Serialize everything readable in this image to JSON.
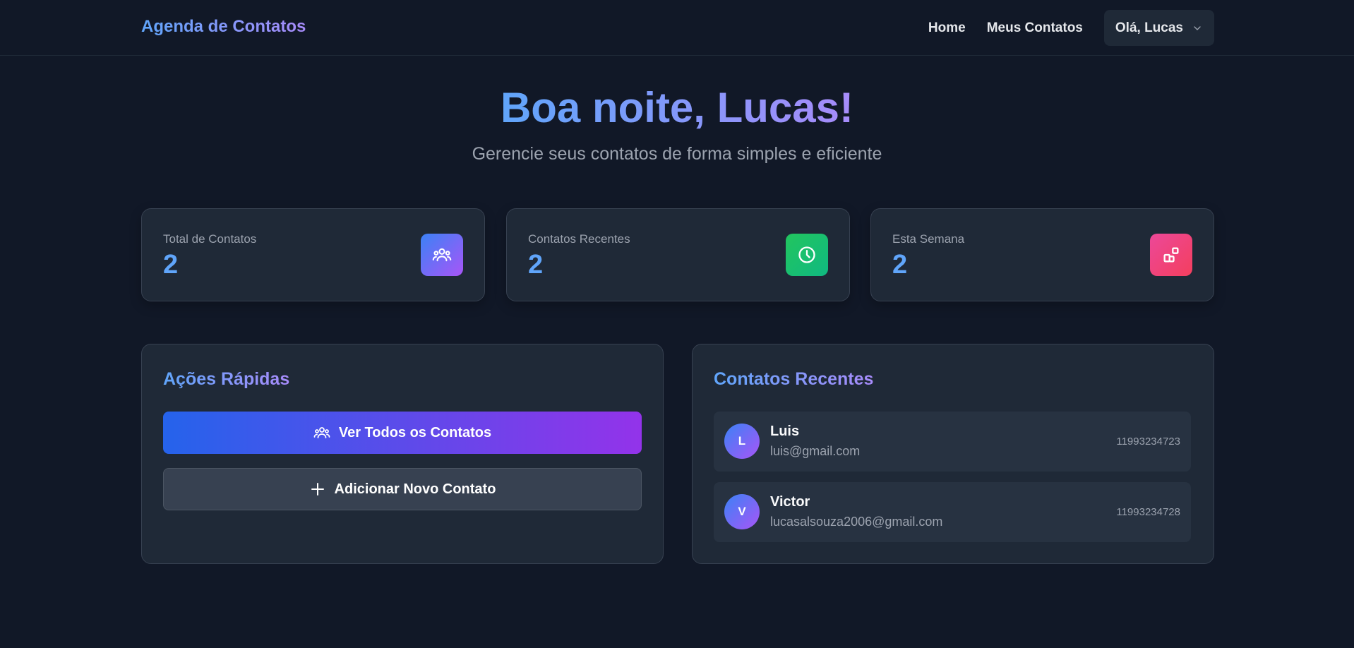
{
  "navbar": {
    "brand": "Agenda de Contatos",
    "links": [
      "Home",
      "Meus Contatos"
    ],
    "user_menu_label": "Olá, Lucas"
  },
  "hero": {
    "title": "Boa noite, Lucas!",
    "subtitle": "Gerencie seus contatos de forma simples e eficiente"
  },
  "stats": [
    {
      "label": "Total de Contatos",
      "value": "2",
      "icon": "users-icon",
      "color_from": "#3b82f6",
      "color_to": "#a855f7"
    },
    {
      "label": "Contatos Recentes",
      "value": "2",
      "icon": "clock-icon",
      "color_from": "#22c55e",
      "color_to": "#10b981"
    },
    {
      "label": "Esta Semana",
      "value": "2",
      "icon": "apps-icon",
      "color_from": "#ec4899",
      "color_to": "#f43f5e"
    }
  ],
  "quick_actions": {
    "title": "Ações Rápidas",
    "view_all_label": "Ver Todos os Contatos",
    "add_new_label": "Adicionar Novo Contato"
  },
  "recent_contacts": {
    "title": "Contatos Recentes",
    "items": [
      {
        "initial": "L",
        "name": "Luis",
        "email": "luis@gmail.com",
        "phone": "11993234723"
      },
      {
        "initial": "V",
        "name": "Victor",
        "email": "lucasalsouza2006@gmail.com",
        "phone": "11993234728"
      }
    ]
  },
  "colors": {
    "background": "#111827",
    "card": "#1f2937",
    "accent_blue": "#60a5fa",
    "accent_purple": "#a78bfa"
  }
}
